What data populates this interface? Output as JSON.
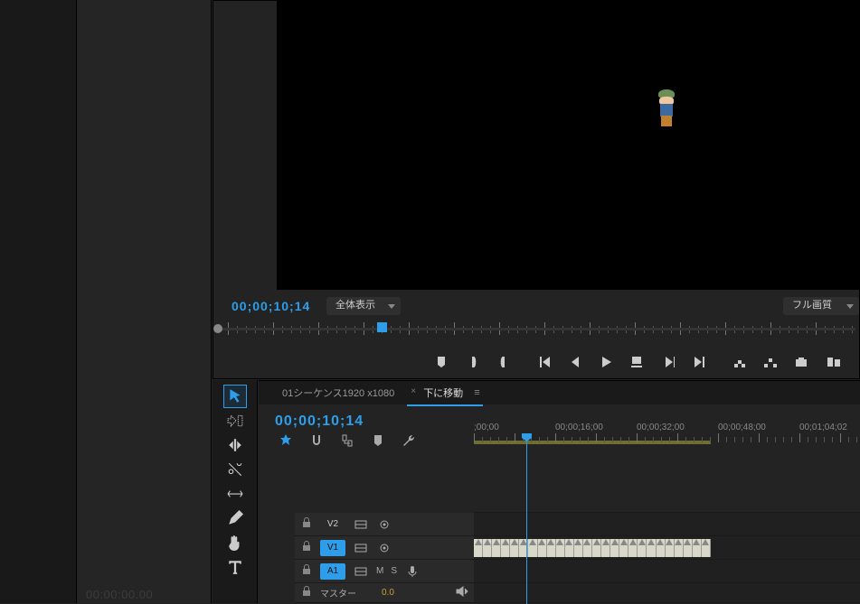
{
  "monitor": {
    "current_time": "00;00;10;14",
    "fit_dropdown": "全体表示",
    "quality_dropdown": "フル画質"
  },
  "left_panel": {
    "timecode": "00:00:00.00"
  },
  "timeline": {
    "tabs": [
      {
        "label": "01シーケンス1920 x1080",
        "active": false
      },
      {
        "label": "下に移動",
        "active": true
      }
    ],
    "current_time": "00;00;10;14",
    "ruler_labels": [
      ";00;00",
      "00;00;16;00",
      "00;00;32;00",
      "00;00;48;00",
      "00;01;04;02"
    ],
    "tracks": {
      "v2": {
        "label": "V2"
      },
      "v1": {
        "label": "V1",
        "is_source": true
      },
      "a1": {
        "label": "A1",
        "is_source": true,
        "m": "M",
        "s": "S"
      },
      "master": {
        "label": "マスター",
        "value": "0.0"
      }
    }
  }
}
